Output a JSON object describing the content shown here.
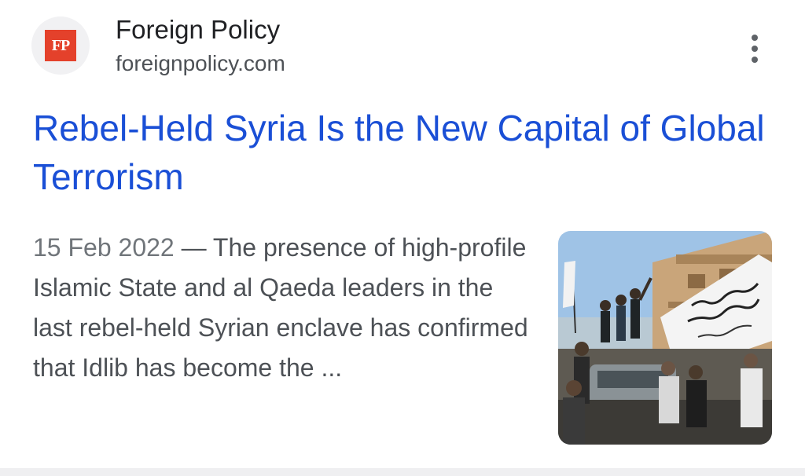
{
  "source": {
    "name": "Foreign Policy",
    "url": "foreignpolicy.com",
    "logo_text": "FP",
    "logo_color": "#e4412b"
  },
  "menu": {
    "icon": "more-vert-icon"
  },
  "result": {
    "title": "Rebel-Held Syria Is the New Capital of Global Terrorism",
    "date": "15 Feb 2022",
    "separator": "—",
    "snippet": "The presence of high-profile Islamic State and al Qaeda leaders in the last rebel-held Syrian enclave has confirmed that Idlib has become the ...",
    "title_color": "#1a4fd6"
  }
}
